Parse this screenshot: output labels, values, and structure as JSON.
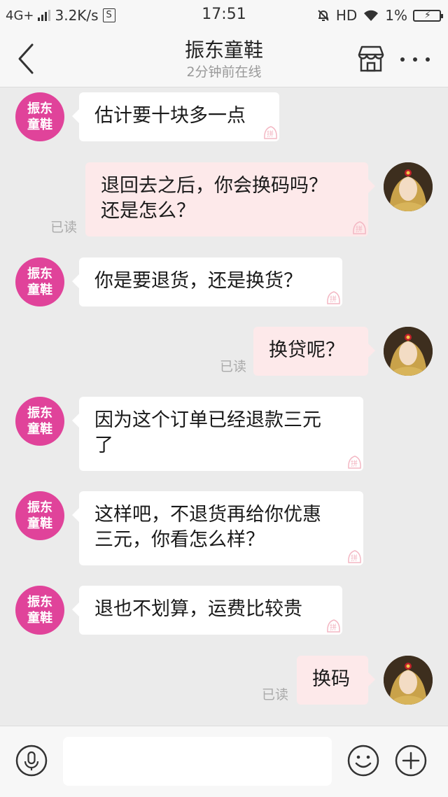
{
  "status_bar": {
    "network": "4G+",
    "speed": "3.2K/s",
    "s_icon_label": "S",
    "time": "17:51",
    "hd": "HD",
    "battery": "1%"
  },
  "header": {
    "title": "振东童鞋",
    "subtitle": "2分钟前在线"
  },
  "shop_avatar": {
    "line1": "振东",
    "line2": "童鞋",
    "color": "#e0439a"
  },
  "messages": [
    {
      "side": "in",
      "lines": [
        "估计要十块多一点"
      ]
    },
    {
      "side": "out",
      "lines": [
        "退回去之后，你会换码吗？",
        "还是怎么？"
      ],
      "status": "已读"
    },
    {
      "side": "in",
      "lines": [
        "你是要退货，还是换货？"
      ]
    },
    {
      "side": "out",
      "lines": [
        "换贷呢？"
      ],
      "status": "已读"
    },
    {
      "side": "in",
      "lines": [
        "因为这个订单已经退款三元",
        "了"
      ]
    },
    {
      "side": "in",
      "lines": [
        "这样吧，不退货再给你优惠",
        "三元，你看怎么样？"
      ]
    },
    {
      "side": "in",
      "lines": [
        "退也不划算，运费比较贵"
      ]
    },
    {
      "side": "out",
      "lines": [
        "换码"
      ],
      "status": "已读"
    }
  ],
  "input_bar": {
    "placeholder": ""
  },
  "colors": {
    "outgoing_bubble": "#fde9ea",
    "incoming_bubble": "#ffffff",
    "chat_background": "#ebebeb"
  }
}
